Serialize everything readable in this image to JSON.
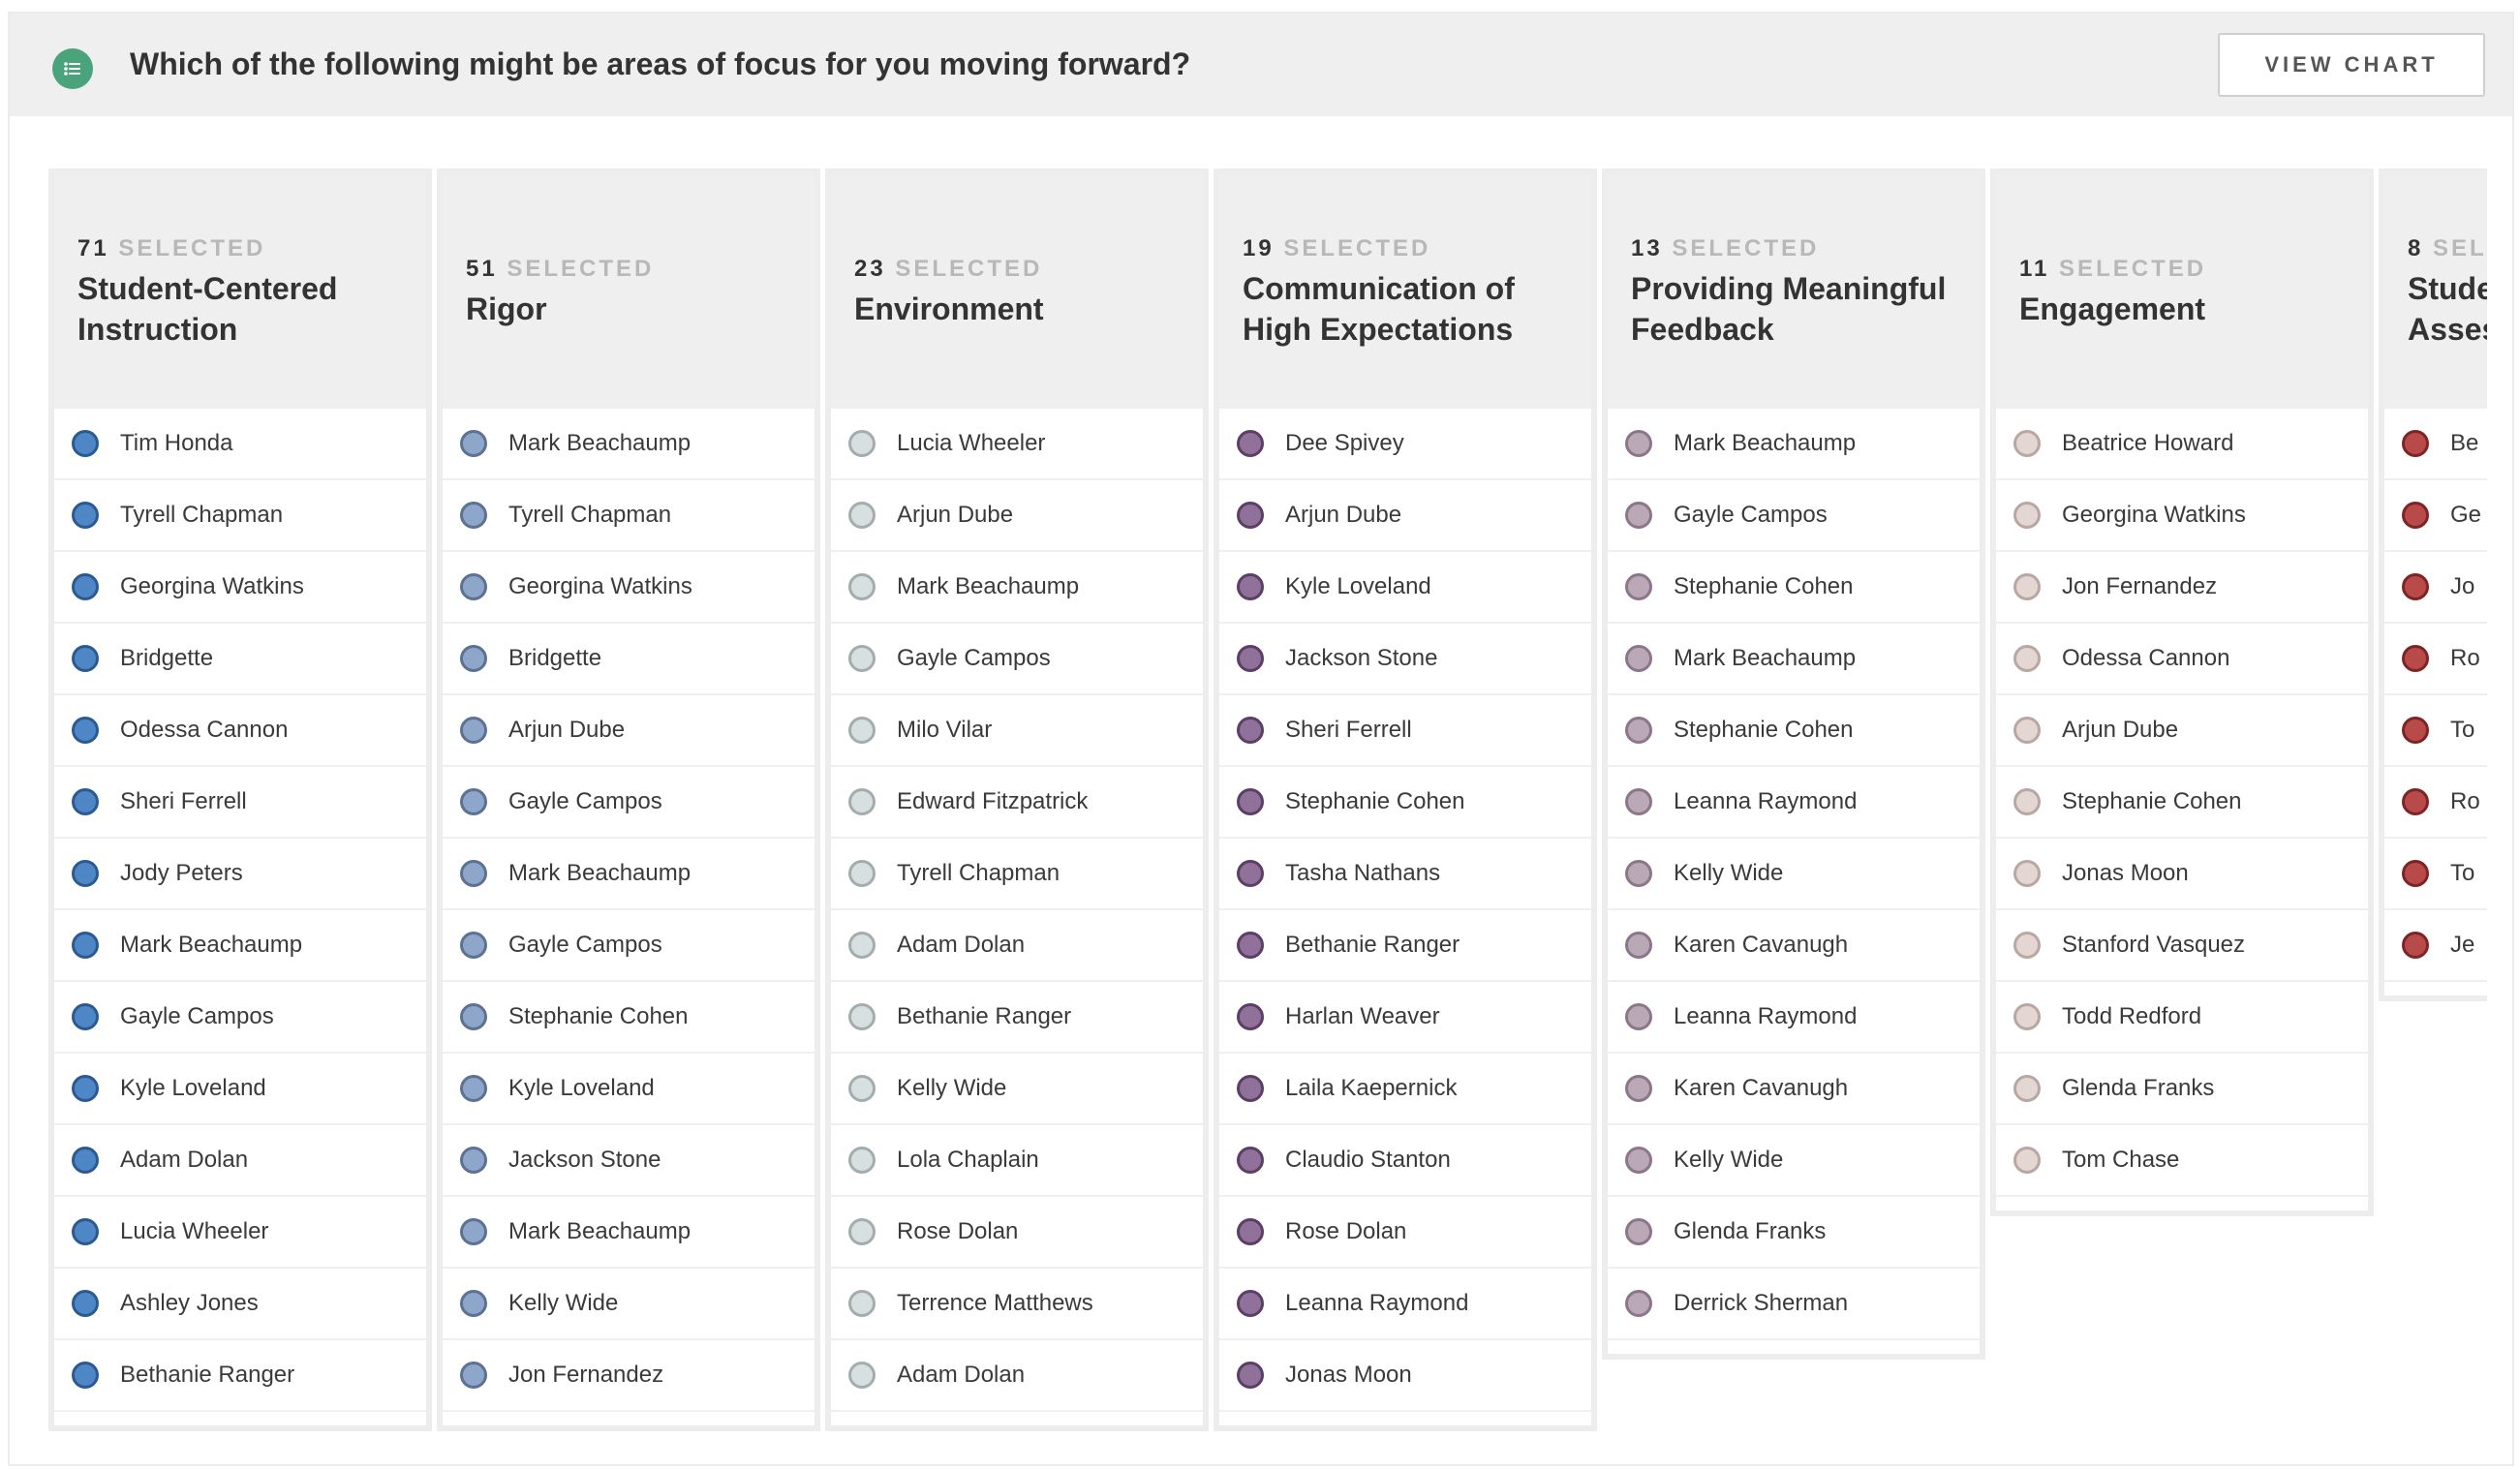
{
  "header": {
    "question": "Which of the following might be areas of focus for you moving forward?",
    "view_chart_label": "VIEW CHART",
    "icon": "list-icon"
  },
  "selected_label": "SELECTED",
  "columns": [
    {
      "count": "71",
      "title_line1": "Student-Centered",
      "title_line2": "Instruction",
      "dot_fill": "#4f86c6",
      "dot_border": "#2a5a91",
      "names": [
        "Tim Honda",
        "Tyrell Chapman",
        "Georgina Watkins",
        "Bridgette",
        "Odessa Cannon",
        "Sheri Ferrell",
        "Jody Peters",
        "Mark Beachaump",
        "Gayle Campos",
        "Kyle Loveland",
        "Adam Dolan",
        "Lucia Wheeler",
        "Ashley Jones",
        "Bethanie Ranger"
      ]
    },
    {
      "count": "51",
      "title_line1": "Rigor",
      "title_line2": "",
      "dot_fill": "#8ea6c9",
      "dot_border": "#5d7193",
      "names": [
        "Mark Beachaump",
        "Tyrell Chapman",
        "Georgina Watkins",
        "Bridgette",
        "Arjun Dube",
        "Gayle Campos",
        "Mark Beachaump",
        "Gayle Campos",
        "Stephanie Cohen",
        "Kyle Loveland",
        "Jackson Stone",
        "Mark Beachaump",
        "Kelly Wide",
        "Jon Fernandez"
      ]
    },
    {
      "count": "23",
      "title_line1": "Environment",
      "title_line2": "",
      "dot_fill": "#d7dfe0",
      "dot_border": "#a4adae",
      "names": [
        "Lucia Wheeler",
        "Arjun Dube",
        "Mark Beachaump",
        "Gayle Campos",
        "Milo Vilar",
        "Edward Fitzpatrick",
        "Tyrell Chapman",
        "Adam Dolan",
        "Bethanie Ranger",
        "Kelly Wide",
        "Lola Chaplain",
        "Rose Dolan",
        "Terrence Matthews",
        "Adam Dolan"
      ]
    },
    {
      "count": "19",
      "title_line1": "Communication of",
      "title_line2": "High Expectations",
      "dot_fill": "#8f7199",
      "dot_border": "#5b3f66",
      "names": [
        "Dee Spivey",
        "Arjun Dube",
        "Kyle Loveland",
        "Jackson Stone",
        "Sheri Ferrell",
        "Stephanie Cohen",
        "Tasha Nathans",
        "Bethanie Ranger",
        "Harlan Weaver",
        "Laila Kaepernick",
        "Claudio Stanton",
        "Rose Dolan",
        "Leanna Raymond",
        "Jonas Moon"
      ]
    },
    {
      "count": "13",
      "title_line1": "Providing Meaningful",
      "title_line2": "Feedback",
      "dot_fill": "#bba8b6",
      "dot_border": "#8c7689",
      "names": [
        "Mark Beachaump",
        "Gayle Campos",
        "Stephanie Cohen",
        "Mark Beachaump",
        "Stephanie Cohen",
        "Leanna Raymond",
        "Kelly Wide",
        "Karen Cavanugh",
        "Leanna Raymond",
        "Karen Cavanugh",
        "Kelly Wide",
        "Glenda Franks",
        "Derrick Sherman"
      ]
    },
    {
      "count": "11",
      "title_line1": "Engagement",
      "title_line2": "",
      "dot_fill": "#e4d6d2",
      "dot_border": "#b8a7a3",
      "names": [
        "Beatrice Howard",
        "Georgina Watkins",
        "Jon Fernandez",
        "Odessa Cannon",
        "Arjun Dube",
        "Stephanie Cohen",
        "Jonas Moon",
        "Stanford Vasquez",
        "Todd Redford",
        "Glenda Franks",
        "Tom Chase"
      ]
    },
    {
      "count": "8",
      "title_line1": "Student",
      "title_line2": "Assessment",
      "dot_fill": "#b94a4a",
      "dot_border": "#7d2424",
      "names": [
        "Be",
        "Ge",
        "Jo",
        "Ro",
        "To",
        "Ro",
        "To",
        "Je"
      ]
    }
  ]
}
